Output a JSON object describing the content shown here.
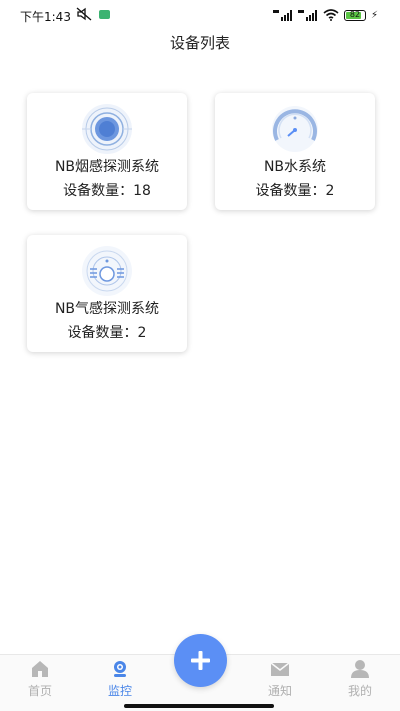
{
  "status_bar": {
    "time": "下午1:43",
    "battery": "82",
    "icons": [
      "mute-icon",
      "app-notification-icon",
      "signal-icon",
      "signal-icon",
      "wifi-icon",
      "battery-icon",
      "charging-icon"
    ]
  },
  "header": {
    "title": "设备列表"
  },
  "devices": [
    {
      "name": "NB烟感探测系统",
      "count_label": "设备数量：18",
      "icon": "smoke-detector-icon"
    },
    {
      "name": "NB水系统",
      "count_label": "设备数量：2",
      "icon": "water-gauge-icon"
    },
    {
      "name": "NB气感探测系统",
      "count_label": "设备数量：2",
      "icon": "gas-detector-icon"
    }
  ],
  "tabbar": {
    "items": [
      {
        "label": "首页",
        "icon": "home-icon",
        "active": false
      },
      {
        "label": "监控",
        "icon": "monitor-icon",
        "active": true
      },
      {
        "label": "通知",
        "icon": "mail-icon",
        "active": false
      },
      {
        "label": "我的",
        "icon": "user-icon",
        "active": false
      }
    ],
    "fab_icon": "plus-icon"
  },
  "colors": {
    "accent": "#4a86e8",
    "fab": "#5b8ff5",
    "inactive": "#b0b0b0"
  }
}
